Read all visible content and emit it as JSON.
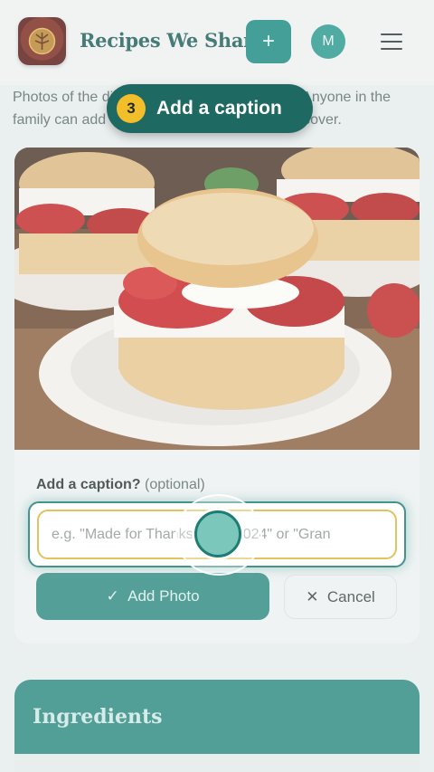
{
  "app": {
    "title": "Recipes We Share",
    "avatar_initial": "M",
    "add_symbol": "+"
  },
  "icons": {
    "logo": "tree-logo-icon",
    "menu": "hamburger-menu-icon",
    "add": "plus-icon",
    "check": "check-icon",
    "close": "x-icon"
  },
  "intro": {
    "text": "Photos of the dish help the family remember. Anyone in the family can add one, and you can set it as the cover."
  },
  "tour": {
    "step": "3",
    "label": "Add a caption"
  },
  "photo_form": {
    "caption_label": "Add a caption?",
    "caption_optional": "(optional)",
    "caption_placeholder": "e.g. \"Made for Thanksgiving 2024\" or \"Gran",
    "add_button": "Add Photo",
    "cancel_button": "Cancel"
  },
  "sections": {
    "ingredients_title": "Ingredients"
  },
  "colors": {
    "teal": "#1a8a80",
    "dark_teal": "#1e6a62",
    "gold": "#f2be2a",
    "input_border": "#d7b63e"
  }
}
